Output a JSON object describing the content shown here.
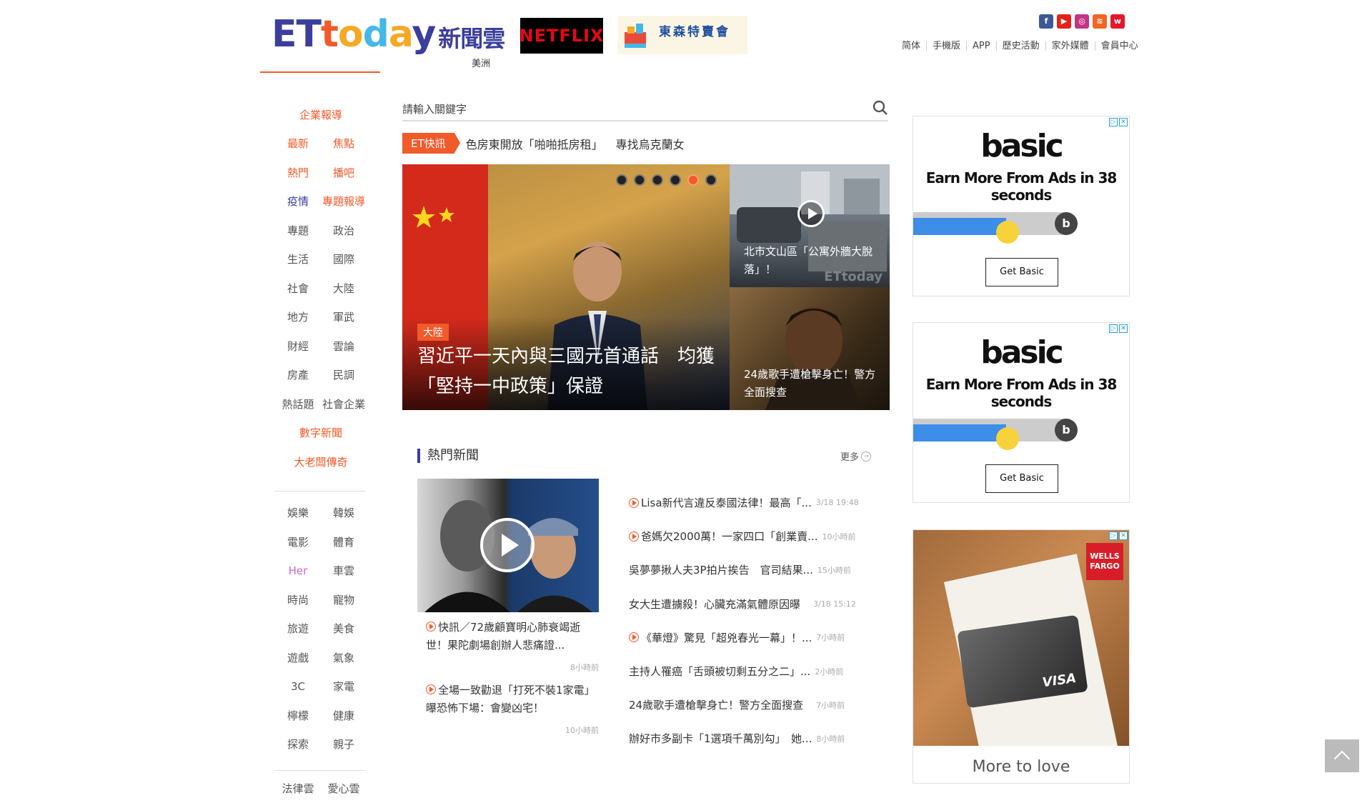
{
  "header": {
    "logo_parts": [
      "ET",
      "t",
      "o",
      "d",
      "a",
      "y"
    ],
    "logo_cn": "新聞雲",
    "region": "美洲",
    "netflix_label": "NETFLIX",
    "tokyo_label": "東森特賣會",
    "social_icons": [
      "facebook-icon",
      "youtube-icon",
      "instagram-icon",
      "rss-icon",
      "weibo-icon"
    ],
    "topnav": [
      "简体",
      "手機版",
      "APP",
      "歷史活動",
      "家外媒體",
      "會員中心"
    ]
  },
  "sidebar": {
    "rows": [
      [
        "企業報導"
      ],
      [
        "最新",
        "焦點"
      ],
      [
        "熱門",
        "播吧"
      ],
      [
        "疫情",
        "專題報導"
      ],
      [
        "專題",
        "政治"
      ],
      [
        "生活",
        "國際"
      ],
      [
        "社會",
        "大陸"
      ],
      [
        "地方",
        "軍武"
      ],
      [
        "財經",
        "雲論"
      ],
      [
        "房產",
        "民調"
      ],
      [
        "熱話題",
        "社會企業"
      ],
      [
        "數字新聞"
      ],
      [
        "大老闆傳奇"
      ]
    ],
    "rows2": [
      [
        "娛樂",
        "韓娛"
      ],
      [
        "電影",
        "體育"
      ],
      [
        "Her",
        "車雲"
      ],
      [
        "時尚",
        "寵物"
      ],
      [
        "旅遊",
        "美食"
      ],
      [
        "遊戲",
        "氣象"
      ],
      [
        "3C",
        "家電"
      ],
      [
        "檸檬",
        "健康"
      ],
      [
        "探索",
        "親子"
      ]
    ],
    "rows3": [
      [
        "法律雲",
        "愛心雲"
      ]
    ]
  },
  "search": {
    "placeholder": "請輸入關鍵字"
  },
  "flash": {
    "tag": "ET快訊",
    "items": [
      "色房東開放「啪啪抵房租」",
      "專找烏克蘭女"
    ]
  },
  "hero": {
    "badge": "大陸",
    "title": "習近平一天內與三國元首通話　均獲「堅持一中政策」保證",
    "side1_caption": "北市文山區「公寓外牆大脫落」！",
    "side1_watermark": "ETtoday",
    "side2_caption": "24歲歌手遭槍擊身亡！警方全面搜查",
    "active_dot": 4
  },
  "hot_news": {
    "title": "熱門新聞",
    "more": "更多",
    "left": [
      {
        "title": "快訊／72歲顧寶明心肺衰竭逝世！果陀劇場創辦人悲痛證...",
        "time": "8小時前"
      },
      {
        "title": "全場一致勸退「打死不裝1家電」　曝恐怖下場：會變凶宅！",
        "time": "10小時前"
      }
    ],
    "right": [
      {
        "title": "Lisa新代言違反泰國法律！最高「...",
        "time": "3/18 19:48",
        "video": true
      },
      {
        "title": "爸媽欠2000萬！一家四口「創業賣...",
        "time": "10小時前",
        "video": true
      },
      {
        "title": "吳夢夢揪人夫3P拍片挨告　官司結果...",
        "time": "15小時前",
        "video": false
      },
      {
        "title": "女大生遭擄殺！心臟充滿氣體原因曝",
        "time": "3/18 15:12",
        "video": false
      },
      {
        "title": "《華燈》驚見「超兇春光一幕」！...",
        "time": "7小時前",
        "video": true
      },
      {
        "title": "主持人罹癌「舌頭被切剩五分之二」...",
        "time": "2小時前",
        "video": false
      },
      {
        "title": "24歲歌手遭槍擊身亡！警方全面搜查",
        "time": "7小時前",
        "video": false
      },
      {
        "title": "辦好市多副卡「1選項千萬別勾」　她...",
        "time": "8小時前",
        "video": false
      }
    ]
  },
  "ads": {
    "basic_brand": "basic",
    "basic_tagline": "Earn More From Ads in 38 seconds",
    "basic_button": "Get Basic",
    "wf_logo": "WELLS FARGO",
    "wf_card_brand": "VISA",
    "wf_bottom": "More to love",
    "ad_choices": "▷",
    "ad_close": "✕"
  },
  "colors": {
    "accent": "#f15a29",
    "brand_blue": "#3b3e9c"
  }
}
